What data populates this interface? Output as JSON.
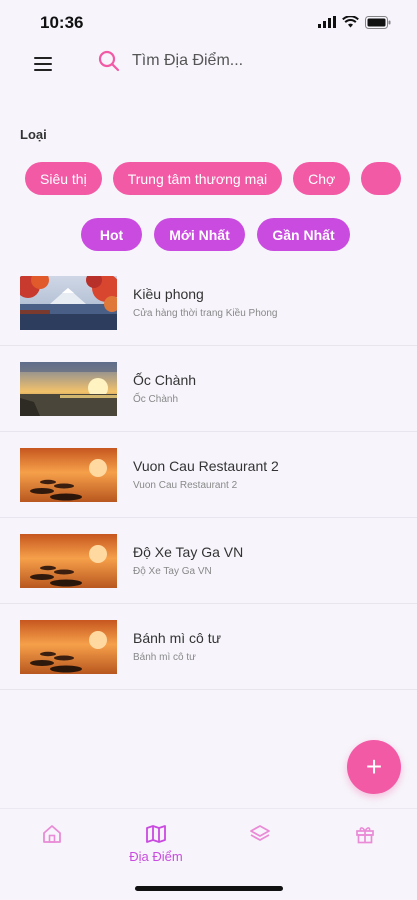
{
  "status_bar": {
    "time": "10:36"
  },
  "search": {
    "placeholder": "Tìm Địa Điểm..."
  },
  "filters": {
    "label": "Loại",
    "categories": [
      "Siêu thị",
      "Trung tâm thương mại",
      "Chợ"
    ],
    "sorts": [
      "Hot",
      "Mới Nhất",
      "Gần Nhất"
    ]
  },
  "places": [
    {
      "title": "Kiều phong",
      "subtitle": "Cửa hàng thời trang Kiều Phong",
      "image": "autumn-mountain-lake"
    },
    {
      "title": "Ốc Chành",
      "subtitle": "Ốc Chành",
      "image": "sunset-sea"
    },
    {
      "title": "Vuon Cau Restaurant 2",
      "subtitle": "Vuon Cau Restaurant 2",
      "image": "sunset-stepping-stones"
    },
    {
      "title": "Độ Xe Tay Ga VN",
      "subtitle": "Độ Xe Tay Ga VN",
      "image": "sunset-stepping-stones"
    },
    {
      "title": "Bánh mì cô tư",
      "subtitle": "Bánh mì cô tư",
      "image": "sunset-stepping-stones"
    }
  ],
  "fab": {
    "label": "+"
  },
  "bottom_nav": {
    "items": [
      {
        "icon": "home-icon",
        "label": ""
      },
      {
        "icon": "map-icon",
        "label": "Địa Điểm"
      },
      {
        "icon": "layers-icon",
        "label": ""
      },
      {
        "icon": "gift-icon",
        "label": ""
      }
    ],
    "active_index": 1
  },
  "colors": {
    "accent_pink": "#f25aa6",
    "accent_purple": "#c94bdf",
    "background": "#f7f5fb"
  }
}
